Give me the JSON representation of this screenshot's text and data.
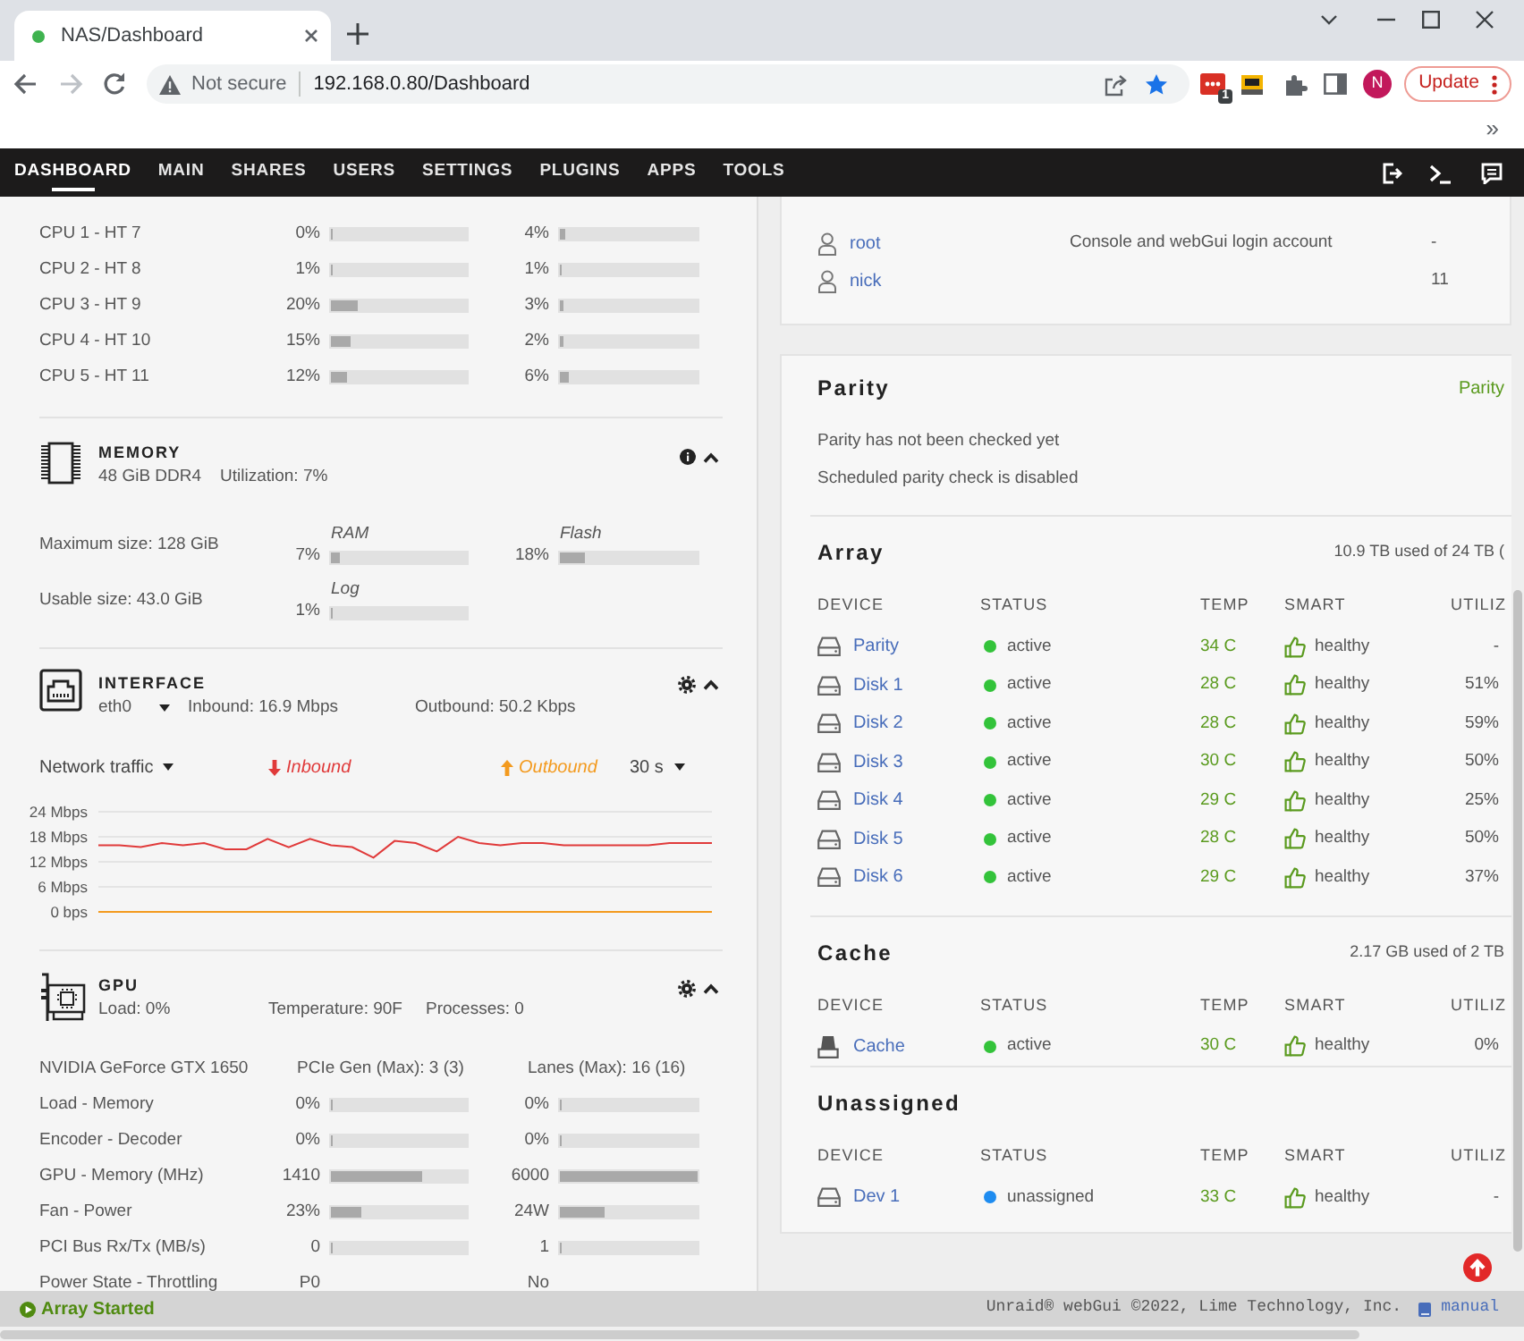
{
  "browser": {
    "tab": {
      "title": "NAS/Dashboard"
    },
    "security": "Not secure",
    "url": "192.168.0.80/Dashboard",
    "extension_badge": "1",
    "profile": "N",
    "update_button": "Update",
    "bookmarks_more": "»"
  },
  "nav": {
    "items": [
      {
        "label": "DASHBOARD",
        "selected": true
      },
      {
        "label": "MAIN",
        "selected": false
      },
      {
        "label": "SHARES",
        "selected": false
      },
      {
        "label": "USERS",
        "selected": false
      },
      {
        "label": "SETTINGS",
        "selected": false
      },
      {
        "label": "PLUGINS",
        "selected": false
      },
      {
        "label": "APPS",
        "selected": false
      },
      {
        "label": "TOOLS",
        "selected": false
      }
    ]
  },
  "cpu": {
    "rows": [
      {
        "label": "CPU 1 - HT 7",
        "values": [
          {
            "reading": "0%",
            "level": 0
          },
          {
            "reading": "4%",
            "level": 0.04
          }
        ]
      },
      {
        "label": "CPU 2 - HT 8",
        "values": [
          {
            "reading": "1%",
            "level": 0.01
          },
          {
            "reading": "1%",
            "level": 0.01
          }
        ]
      },
      {
        "label": "CPU 3 - HT 9",
        "values": [
          {
            "reading": "20%",
            "level": 0.2
          },
          {
            "reading": "3%",
            "level": 0.03
          }
        ]
      },
      {
        "label": "CPU 4 - HT 10",
        "values": [
          {
            "reading": "15%",
            "level": 0.15
          },
          {
            "reading": "2%",
            "level": 0.02
          }
        ]
      },
      {
        "label": "CPU 5 - HT 11",
        "values": [
          {
            "reading": "12%",
            "level": 0.12
          },
          {
            "reading": "6%",
            "level": 0.06
          }
        ]
      }
    ]
  },
  "memory": {
    "title": "MEMORY",
    "summary": "48 GiB DDR4",
    "utilization": "Utilization: 7%",
    "rows": [
      {
        "text": "Maximum size: 128 GiB",
        "meters": [
          {
            "name": "RAM",
            "reading": "7%",
            "level": 0.07
          },
          {
            "name": "Flash",
            "reading": "18%",
            "level": 0.18
          }
        ]
      },
      {
        "text": "Usable size: 43.0 GiB",
        "meters": [
          {
            "name": "Log",
            "reading": "1%",
            "level": 0.01
          }
        ]
      }
    ]
  },
  "interface": {
    "title": "INTERFACE",
    "port": "eth0",
    "inbound": "Inbound: 16.9 Mbps",
    "outbound": "Outbound: 50.2 Kbps",
    "graph_select": "Network traffic",
    "interval_select": "30 s",
    "chart_data": {
      "type": "line",
      "grid": true,
      "ylim": [
        0,
        24
      ],
      "yticks": [
        {
          "value": 24,
          "label": "24 Mbps"
        },
        {
          "value": 18,
          "label": "18 Mbps"
        },
        {
          "value": 12,
          "label": "12 Mbps"
        },
        {
          "value": 6,
          "label": "6 Mbps"
        },
        {
          "value": 0,
          "label": "0 bps"
        }
      ],
      "series": [
        {
          "name": "Inbound",
          "color": "#e03a3a",
          "values": [
            16,
            16,
            15.5,
            16.5,
            16,
            16.5,
            15,
            15,
            17.5,
            15.5,
            17.5,
            16,
            15.5,
            13,
            17,
            16.5,
            14.5,
            18,
            16.5,
            16,
            16.5,
            16.5,
            16,
            16,
            16,
            16,
            16,
            16.5,
            16.5,
            16.5
          ]
        },
        {
          "name": "Outbound",
          "color": "#f39a1e",
          "values": [
            0,
            0,
            0,
            0,
            0,
            0,
            0,
            0,
            0,
            0,
            0,
            0,
            0,
            0,
            0,
            0,
            0,
            0,
            0,
            0,
            0,
            0,
            0,
            0,
            0,
            0,
            0,
            0,
            0,
            0
          ]
        }
      ]
    }
  },
  "gpu": {
    "title": "GPU",
    "load": "Load: 0%",
    "temperature": "Temperature: 90F",
    "processes": "Processes: 0",
    "info": [
      "NVIDIA GeForce GTX 1650",
      "PCIe Gen (Max): 3 (3)",
      "Lanes (Max): 16 (16)"
    ],
    "rows": [
      {
        "label": "Load - Memory",
        "kind": "meter",
        "values": [
          {
            "reading": "0%",
            "level": 0
          },
          {
            "reading": "0%",
            "level": 0
          }
        ]
      },
      {
        "label": "Encoder - Decoder",
        "kind": "meter",
        "values": [
          {
            "reading": "0%",
            "level": 0
          },
          {
            "reading": "0%",
            "level": 0
          }
        ]
      },
      {
        "label": "GPU - Memory (MHz)",
        "kind": "meter",
        "values": [
          {
            "reading": "1410",
            "level": 0.67
          },
          {
            "reading": "6000",
            "level": 1
          }
        ]
      },
      {
        "label": "Fan - Power",
        "kind": "meter",
        "values": [
          {
            "reading": "23%",
            "level": 0.23
          },
          {
            "reading": "24W",
            "level": 0.33
          }
        ]
      },
      {
        "label": "PCI Bus Rx/Tx (MB/s)",
        "kind": "meter",
        "values": [
          {
            "reading": "0",
            "level": 0
          },
          {
            "reading": "1",
            "level": 0
          }
        ]
      },
      {
        "label": "Power State - Throttling",
        "kind": "text",
        "values": [
          {
            "reading": "P0"
          },
          {
            "reading": "No"
          }
        ]
      }
    ]
  },
  "users": {
    "rows": [
      {
        "name": "root",
        "description": "Console and webGui login account",
        "write": "-"
      },
      {
        "name": "nick",
        "write": "11"
      }
    ]
  },
  "parity": {
    "title": "Parity",
    "link": "Parity",
    "lines": [
      "Parity has not been checked yet",
      "Scheduled parity check is disabled"
    ]
  },
  "pools": [
    {
      "title": "Array",
      "usage": "10.9 TB used of 24 TB (",
      "columns": [
        "DEVICE",
        "STATUS",
        "TEMP",
        "SMART",
        "UTILIZ"
      ],
      "rows": [
        {
          "kind": "hdd",
          "device": "Parity",
          "status": "active",
          "color": "#33c33a",
          "temp": "34 C",
          "smart": "healthy",
          "utilization": "-"
        },
        {
          "kind": "hdd",
          "device": "Disk 1",
          "status": "active",
          "color": "#33c33a",
          "temp": "28 C",
          "smart": "healthy",
          "utilization": "51%"
        },
        {
          "kind": "hdd",
          "device": "Disk 2",
          "status": "active",
          "color": "#33c33a",
          "temp": "28 C",
          "smart": "healthy",
          "utilization": "59%"
        },
        {
          "kind": "hdd",
          "device": "Disk 3",
          "status": "active",
          "color": "#33c33a",
          "temp": "30 C",
          "smart": "healthy",
          "utilization": "50%"
        },
        {
          "kind": "hdd",
          "device": "Disk 4",
          "status": "active",
          "color": "#33c33a",
          "temp": "29 C",
          "smart": "healthy",
          "utilization": "25%"
        },
        {
          "kind": "hdd",
          "device": "Disk 5",
          "status": "active",
          "color": "#33c33a",
          "temp": "28 C",
          "smart": "healthy",
          "utilization": "50%"
        },
        {
          "kind": "hdd",
          "device": "Disk 6",
          "status": "active",
          "color": "#33c33a",
          "temp": "29 C",
          "smart": "healthy",
          "utilization": "37%"
        }
      ]
    },
    {
      "title": "Cache",
      "usage": "2.17 GB used of 2 TB",
      "columns": [
        "DEVICE",
        "STATUS",
        "TEMP",
        "SMART",
        "UTILIZ"
      ],
      "rows": [
        {
          "kind": "ssd",
          "device": "Cache",
          "status": "active",
          "color": "#33c33a",
          "temp": "30 C",
          "smart": "healthy",
          "utilization": "0%"
        }
      ]
    },
    {
      "title": "Unassigned",
      "columns": [
        "DEVICE",
        "STATUS",
        "TEMP",
        "SMART",
        "UTILIZ"
      ],
      "rows": [
        {
          "kind": "hdd",
          "device": "Dev 1",
          "status": "unassigned",
          "color": "#1e8cf0",
          "temp": "33 C",
          "smart": "healthy",
          "utilization": "-"
        }
      ]
    }
  ],
  "footer": {
    "status": "Array Started",
    "credit": "Unraid® webGui ©2022, Lime Technology, Inc.",
    "manual": "manual"
  }
}
